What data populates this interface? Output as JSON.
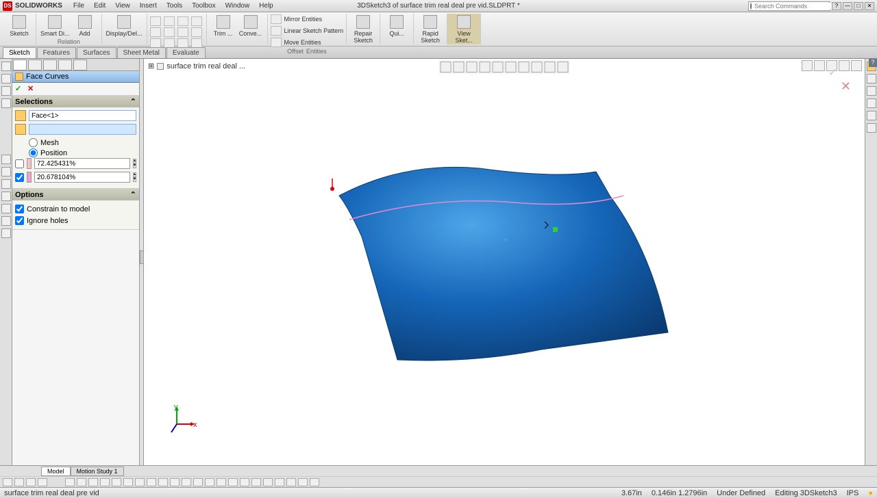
{
  "app": {
    "name": "SOLIDWORKS",
    "doc_title": "3DSketch3 of surface trim real deal pre vid.SLDPRT *"
  },
  "menus": [
    "File",
    "Edit",
    "View",
    "Insert",
    "Tools",
    "Toolbox",
    "Window",
    "Help"
  ],
  "search": {
    "placeholder": "Search Commands"
  },
  "ribbon": {
    "sketch": "Sketch",
    "smart_dim": "Smart Di...",
    "add": "Add",
    "relation": "Relation",
    "display_del": "Display/Del...",
    "trim": "Trim ...",
    "convert": "Conve...",
    "offset": "Offset",
    "entities": "Entities",
    "mirror": "Mirror Entities",
    "linear_pattern": "Linear Sketch Pattern",
    "move": "Move Entities",
    "repair": "Repair",
    "repair_sub": "Sketch",
    "quick": "Qui...",
    "rapid": "Rapid",
    "rapid_sub": "Sketch",
    "view": "View",
    "view_sub": "Sket..."
  },
  "tabs": [
    "Sketch",
    "Features",
    "Surfaces",
    "Sheet Metal",
    "Evaluate"
  ],
  "breadcrumb": "surface trim real deal ...",
  "pm": {
    "title": "Face Curves",
    "selections_label": "Selections",
    "face_value": "Face<1>",
    "mesh_label": "Mesh",
    "position_label": "Position",
    "u_value": "72.425431%",
    "v_value": "20.678104%",
    "options_label": "Options",
    "constrain_label": "Constrain to model",
    "ignore_label": "Ignore holes"
  },
  "bottom_tabs": [
    "Model",
    "Motion Study 1"
  ],
  "status": {
    "left": "surface trim real deal pre vid",
    "dist": "3.67in",
    "coords": "0.146in 1.2796in",
    "def": "Under Defined",
    "edit": "Editing 3DSketch3",
    "units": "IPS"
  }
}
